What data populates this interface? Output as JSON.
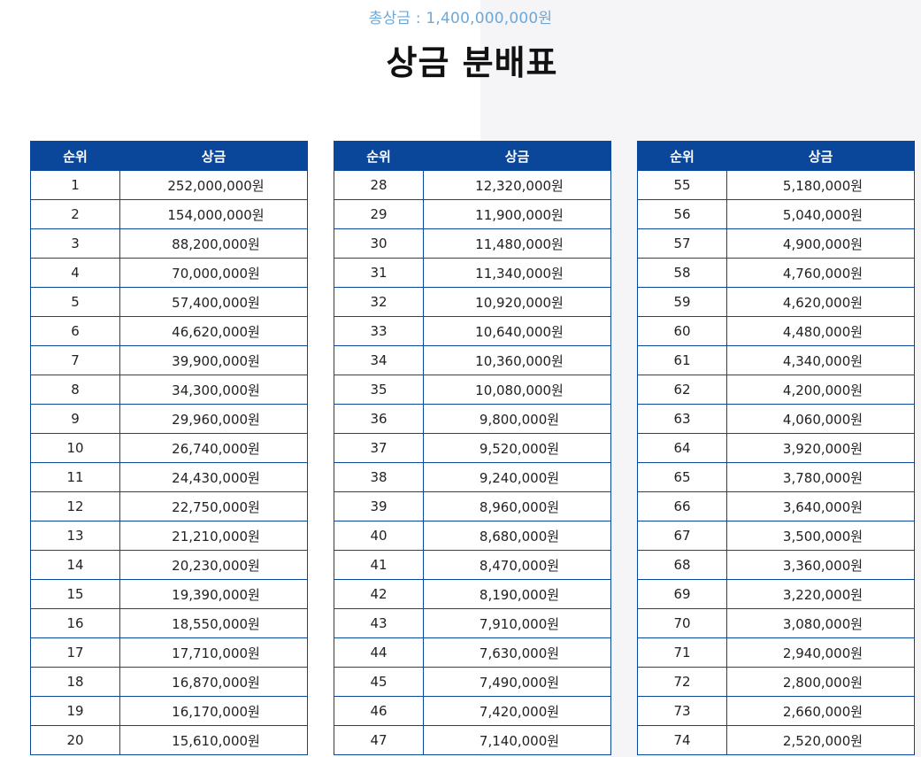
{
  "header": {
    "total_prize": "총상금 : 1,400,000,000원",
    "title": "상금 분배표"
  },
  "table_headers": {
    "rank": "순위",
    "prize": "상금"
  },
  "tables": [
    {
      "rows": [
        {
          "rank": "1",
          "prize": "252,000,000원"
        },
        {
          "rank": "2",
          "prize": "154,000,000원"
        },
        {
          "rank": "3",
          "prize": "88,200,000원"
        },
        {
          "rank": "4",
          "prize": "70,000,000원"
        },
        {
          "rank": "5",
          "prize": "57,400,000원"
        },
        {
          "rank": "6",
          "prize": "46,620,000원"
        },
        {
          "rank": "7",
          "prize": "39,900,000원"
        },
        {
          "rank": "8",
          "prize": "34,300,000원"
        },
        {
          "rank": "9",
          "prize": "29,960,000원"
        },
        {
          "rank": "10",
          "prize": "26,740,000원"
        },
        {
          "rank": "11",
          "prize": "24,430,000원"
        },
        {
          "rank": "12",
          "prize": "22,750,000원"
        },
        {
          "rank": "13",
          "prize": "21,210,000원"
        },
        {
          "rank": "14",
          "prize": "20,230,000원"
        },
        {
          "rank": "15",
          "prize": "19,390,000원"
        },
        {
          "rank": "16",
          "prize": "18,550,000원"
        },
        {
          "rank": "17",
          "prize": "17,710,000원"
        },
        {
          "rank": "18",
          "prize": "16,870,000원"
        },
        {
          "rank": "19",
          "prize": "16,170,000원"
        },
        {
          "rank": "20",
          "prize": "15,610,000원"
        }
      ]
    },
    {
      "rows": [
        {
          "rank": "28",
          "prize": "12,320,000원"
        },
        {
          "rank": "29",
          "prize": "11,900,000원"
        },
        {
          "rank": "30",
          "prize": "11,480,000원"
        },
        {
          "rank": "31",
          "prize": "11,340,000원"
        },
        {
          "rank": "32",
          "prize": "10,920,000원"
        },
        {
          "rank": "33",
          "prize": "10,640,000원"
        },
        {
          "rank": "34",
          "prize": "10,360,000원"
        },
        {
          "rank": "35",
          "prize": "10,080,000원"
        },
        {
          "rank": "36",
          "prize": "9,800,000원"
        },
        {
          "rank": "37",
          "prize": "9,520,000원"
        },
        {
          "rank": "38",
          "prize": "9,240,000원"
        },
        {
          "rank": "39",
          "prize": "8,960,000원"
        },
        {
          "rank": "40",
          "prize": "8,680,000원"
        },
        {
          "rank": "41",
          "prize": "8,470,000원"
        },
        {
          "rank": "42",
          "prize": "8,190,000원"
        },
        {
          "rank": "43",
          "prize": "7,910,000원"
        },
        {
          "rank": "44",
          "prize": "7,630,000원"
        },
        {
          "rank": "45",
          "prize": "7,490,000원"
        },
        {
          "rank": "46",
          "prize": "7,420,000원"
        },
        {
          "rank": "47",
          "prize": "7,140,000원"
        }
      ]
    },
    {
      "rows": [
        {
          "rank": "55",
          "prize": "5,180,000원"
        },
        {
          "rank": "56",
          "prize": "5,040,000원"
        },
        {
          "rank": "57",
          "prize": "4,900,000원"
        },
        {
          "rank": "58",
          "prize": "4,760,000원"
        },
        {
          "rank": "59",
          "prize": "4,620,000원"
        },
        {
          "rank": "60",
          "prize": "4,480,000원"
        },
        {
          "rank": "61",
          "prize": "4,340,000원"
        },
        {
          "rank": "62",
          "prize": "4,200,000원"
        },
        {
          "rank": "63",
          "prize": "4,060,000원"
        },
        {
          "rank": "64",
          "prize": "3,920,000원"
        },
        {
          "rank": "65",
          "prize": "3,780,000원"
        },
        {
          "rank": "66",
          "prize": "3,640,000원"
        },
        {
          "rank": "67",
          "prize": "3,500,000원"
        },
        {
          "rank": "68",
          "prize": "3,360,000원"
        },
        {
          "rank": "69",
          "prize": "3,220,000원"
        },
        {
          "rank": "70",
          "prize": "3,080,000원"
        },
        {
          "rank": "71",
          "prize": "2,940,000원"
        },
        {
          "rank": "72",
          "prize": "2,800,000원"
        },
        {
          "rank": "73",
          "prize": "2,660,000원"
        },
        {
          "rank": "74",
          "prize": "2,520,000원"
        }
      ]
    }
  ],
  "colors": {
    "header_bg": "#0a4699",
    "subtitle_text": "#6fa8d6",
    "title_text": "#111111",
    "border": "#0a4699"
  }
}
